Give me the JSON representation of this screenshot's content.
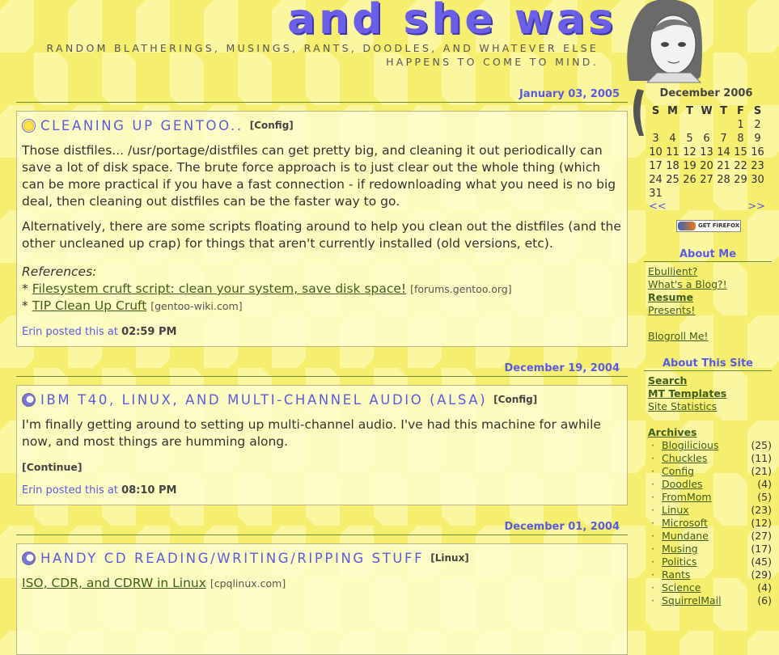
{
  "site": {
    "title": "and she was",
    "tagline": "RANDOM BLATHERINGS, MUSINGS, RANTS, DOODLES, AND WHATEVER ELSE HAPPENS TO COME TO MIND."
  },
  "entries": [
    {
      "date": "January 03, 2005",
      "icon": "sun-icon",
      "title": "CLEANING UP GENTOO..",
      "category": "[Config]",
      "paragraphs": [
        "Those distfiles... /usr/portage/distfiles can get pretty big, and cleaning it out periodically can save a lot of disk space. The brute force approach is to just clear out the whole thing (which can be more practical if you have a fast connection - if redownloading what you need is no big deal, then cleaning out distfiles can be the faster way to go.",
        "Alternatively, there are some scripts floating around to help you clean out the distfiles (and the other uncleaned up crap) for things that aren't currently installed (old versions, etc)."
      ],
      "references_label": "References:",
      "references": [
        {
          "prefix": "* ",
          "text": "Filesystem cruft script: clean your system, save disk space!",
          "source": "[forums.gentoo.org]"
        },
        {
          "prefix": "* ",
          "text": "TIP Clean Up Cruft",
          "source": "[gentoo-wiki.com]"
        }
      ],
      "posted_prefix": "Erin posted this at",
      "time": "02:59 PM"
    },
    {
      "date": "December 19, 2004",
      "icon": "moon-icon",
      "title": "IBM T40, LINUX, AND MULTI-CHANNEL AUDIO (ALSA)",
      "category": "[Config]",
      "paragraphs": [
        "I'm finally getting around to setting up multi-channel audio. I've had this machine for awhile now, and most things are humming along."
      ],
      "continue": "[Continue]",
      "posted_prefix": "Erin posted this at",
      "time": "08:10 PM"
    },
    {
      "date": "December 01, 2004",
      "icon": "moon-icon",
      "title": "HANDY CD READING/WRITING/RIPPING STUFF",
      "category": "[Linux]",
      "link": {
        "text": "ISO, CDR, and CDRW in Linux",
        "source": "[cpqlinux.com]"
      }
    }
  ],
  "calendar": {
    "title": "December 2006",
    "weekdays": [
      "S",
      "M",
      "T",
      "W",
      "T",
      "F",
      "S"
    ],
    "weeks": [
      [
        "",
        "",
        "",
        "",
        "",
        "1",
        "2"
      ],
      [
        "3",
        "4",
        "5",
        "6",
        "7",
        "8",
        "9"
      ],
      [
        "10",
        "11",
        "12",
        "13",
        "14",
        "15",
        "16"
      ],
      [
        "17",
        "18",
        "19",
        "20",
        "21",
        "22",
        "23"
      ],
      [
        "24",
        "25",
        "26",
        "27",
        "28",
        "29",
        "30"
      ],
      [
        "31",
        "",
        "",
        "",
        "",
        "",
        ""
      ]
    ],
    "prev": "<<",
    "next": ">>"
  },
  "firefox_button": "GET FIREFOX",
  "about_me": {
    "heading": "About Me",
    "links": [
      "Ebullient?",
      "What's a Blog?!",
      "Resume",
      "Presents!"
    ],
    "blogroll": "Blogroll Me!"
  },
  "about_site": {
    "heading": "About This Site",
    "links": [
      "Search",
      "MT Templates",
      "Site Statistics"
    ]
  },
  "archives": {
    "heading": "Archives",
    "items": [
      {
        "name": "Blogilicious",
        "count": "(25)"
      },
      {
        "name": "Chuckles",
        "count": "(11)"
      },
      {
        "name": "Config",
        "count": "(21)"
      },
      {
        "name": "Doodles",
        "count": "(4)"
      },
      {
        "name": "FromMom",
        "count": "(5)"
      },
      {
        "name": "Linux",
        "count": "(23)"
      },
      {
        "name": "Microsoft",
        "count": "(12)"
      },
      {
        "name": "Mundane",
        "count": "(27)"
      },
      {
        "name": "Musing",
        "count": "(17)"
      },
      {
        "name": "Politics",
        "count": "(45)"
      },
      {
        "name": "Rants",
        "count": "(29)"
      },
      {
        "name": "Science",
        "count": "(4)"
      },
      {
        "name": "SquirrelMail",
        "count": "(6)"
      }
    ]
  },
  "colors": {
    "accent": "#5b5be0",
    "link": "#3f5e1b",
    "background": "#fbf6a0"
  }
}
